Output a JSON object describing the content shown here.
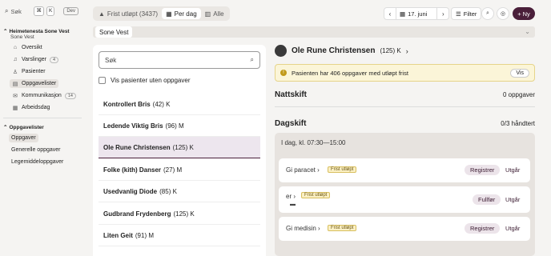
{
  "sidebar": {
    "search_label": "Søk",
    "kbd_cmd": "⌘",
    "kbd_k": "K",
    "dev_label": "Dev",
    "org_title": "Heimetenesta Sone Vest",
    "org_sub": "Sone Vest",
    "items": [
      {
        "label": "Oversikt",
        "icon": "home-icon"
      },
      {
        "label": "Varslinger",
        "count": "4",
        "icon": "bell-icon"
      },
      {
        "label": "Pasienter",
        "icon": "user-icon"
      },
      {
        "label": "Oppgavelister",
        "icon": "list-icon",
        "active": true
      },
      {
        "label": "Kommunikasjon",
        "count": "14",
        "icon": "chat-icon"
      },
      {
        "label": "Arbeidsdag",
        "icon": "calendar-icon"
      }
    ],
    "lists_title": "Oppgavelister",
    "lists": [
      "Oppgaver",
      "Generelle oppgaver",
      "Legemiddeloppgaver"
    ]
  },
  "topbar": {
    "tabs": [
      {
        "label": "Frist utløpt (3437)",
        "icon": "warning-icon"
      },
      {
        "label": "Per dag",
        "icon": "calendar-icon"
      },
      {
        "label": "Alle",
        "icon": "grid-icon"
      }
    ],
    "date": "17. juni",
    "filter_label": "Filter",
    "new_label": "Ny"
  },
  "unit": "Sone Vest",
  "list": {
    "search_placeholder": "Søk",
    "checkbox_label": "Vis pasienter uten oppgaver",
    "patients": [
      {
        "name": "Kontrollert Bris",
        "info": "(42) K"
      },
      {
        "name": "Ledende Viktig Bris",
        "info": "(96) M"
      },
      {
        "name": "Ole Rune Christensen",
        "info": "(125) K"
      },
      {
        "name": "Folke (kith) Danser",
        "info": "(27) M"
      },
      {
        "name": "Usedvanlig Diode",
        "info": "(85) K"
      },
      {
        "name": "Gudbrand Frydenberg",
        "info": "(125) K"
      },
      {
        "name": "Liten Geit",
        "info": "(91) M"
      }
    ]
  },
  "detail": {
    "name": "Ole Rune Christensen",
    "info": "(125) K",
    "alert_text": "Pasienten har 406 oppgaver med utløpt frist",
    "alert_button": "Vis",
    "night_title": "Nattskift",
    "night_count": "0 oppgaver",
    "day_title": "Dagskift",
    "day_count": "0/3 håndtert",
    "time_label": "I dag, kl. 07:30—15:00",
    "tasks": [
      {
        "name": "Gi paracet",
        "badge": "Frist utløpt",
        "action": "Registrer",
        "link": "Utgår"
      },
      {
        "name": "er",
        "badge": "Frist utløpt",
        "action": "Fullfør",
        "link": "Utgår"
      },
      {
        "name": "Gi medisin",
        "badge": "Frist utløpt",
        "action": "Registrer",
        "link": "Utgår"
      }
    ]
  }
}
